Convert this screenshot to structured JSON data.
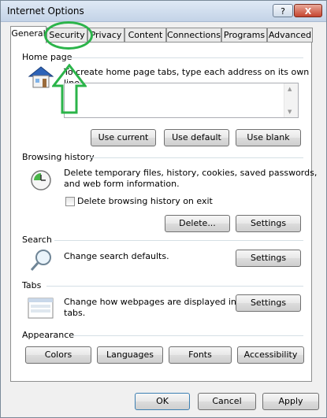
{
  "window": {
    "title": "Internet Options",
    "help_label": "?",
    "close_label": "X"
  },
  "tabs": [
    {
      "label": "General"
    },
    {
      "label": "Security"
    },
    {
      "label": "Privacy"
    },
    {
      "label": "Content"
    },
    {
      "label": "Connections"
    },
    {
      "label": "Programs"
    },
    {
      "label": "Advanced"
    }
  ],
  "home_page": {
    "heading": "Home page",
    "description": "To create home page tabs, type each address on its own line.",
    "value": "",
    "buttons": {
      "use_current": "Use current",
      "use_default": "Use default",
      "use_blank": "Use blank"
    }
  },
  "browsing_history": {
    "heading": "Browsing history",
    "description_line1": "Delete temporary files, history, cookies, saved passwords,",
    "description_line2": "and web form information.",
    "checkbox_label": "Delete browsing history on exit",
    "checkbox_checked": false,
    "buttons": {
      "delete": "Delete...",
      "settings": "Settings"
    }
  },
  "search": {
    "heading": "Search",
    "description": "Change search defaults.",
    "settings": "Settings"
  },
  "tabs_section": {
    "heading": "Tabs",
    "description_line1": "Change how webpages are displayed in",
    "description_line2": "tabs.",
    "settings": "Settings"
  },
  "appearance": {
    "heading": "Appearance",
    "buttons": {
      "colors": "Colors",
      "languages": "Languages",
      "fonts": "Fonts",
      "accessibility": "Accessibility"
    }
  },
  "footer": {
    "ok": "OK",
    "cancel": "Cancel",
    "apply": "Apply"
  },
  "annotation": {
    "color": "#2bb44a"
  }
}
